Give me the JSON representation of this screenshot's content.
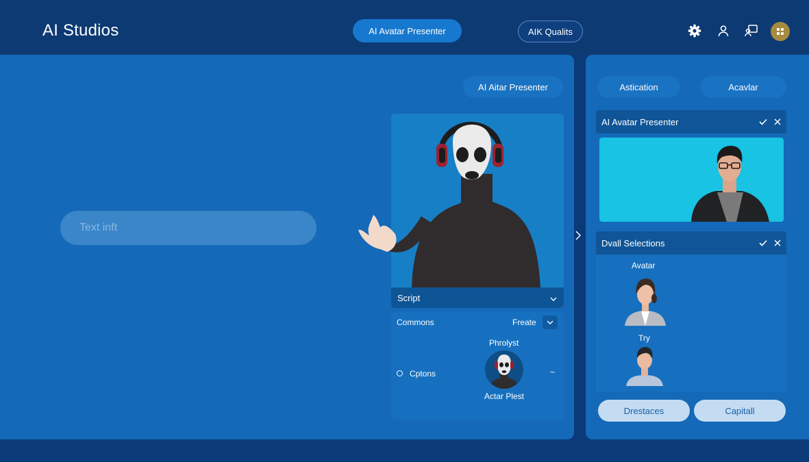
{
  "header": {
    "brand": "AI Studios",
    "primary_pill": "AI Avatar Presenter",
    "secondary_pill": "AIK Qualits",
    "icons": [
      "gear-icon",
      "user-icon",
      "presenter-icon",
      "avatar-badge-icon"
    ]
  },
  "main": {
    "text_input_placeholder": "Text inft",
    "preview_pill": "AI Aitar Presenter",
    "script_label": "Script",
    "options": {
      "commons_label": "Commons",
      "freate_label": "Freate",
      "phrolyst_label": "Phrolyst",
      "options_label": "Cptons",
      "avatar_caption": "Actar Plest",
      "tilde": "~"
    }
  },
  "right": {
    "tabs": [
      "Astication",
      "Acavlar"
    ],
    "card1_title": "AI Avatar Presenter",
    "card2_title": "Dvall Selections",
    "avatar_label": "Avatar",
    "try_label": "Try",
    "buttons": [
      "Drestaces",
      "Capitall"
    ]
  },
  "colors": {
    "header_bg": "#0d3a73",
    "panel_bg": "#1469b8",
    "accent": "#1679cf",
    "video_bg": "#18c3e3",
    "button_light": "#c3dcf2"
  }
}
